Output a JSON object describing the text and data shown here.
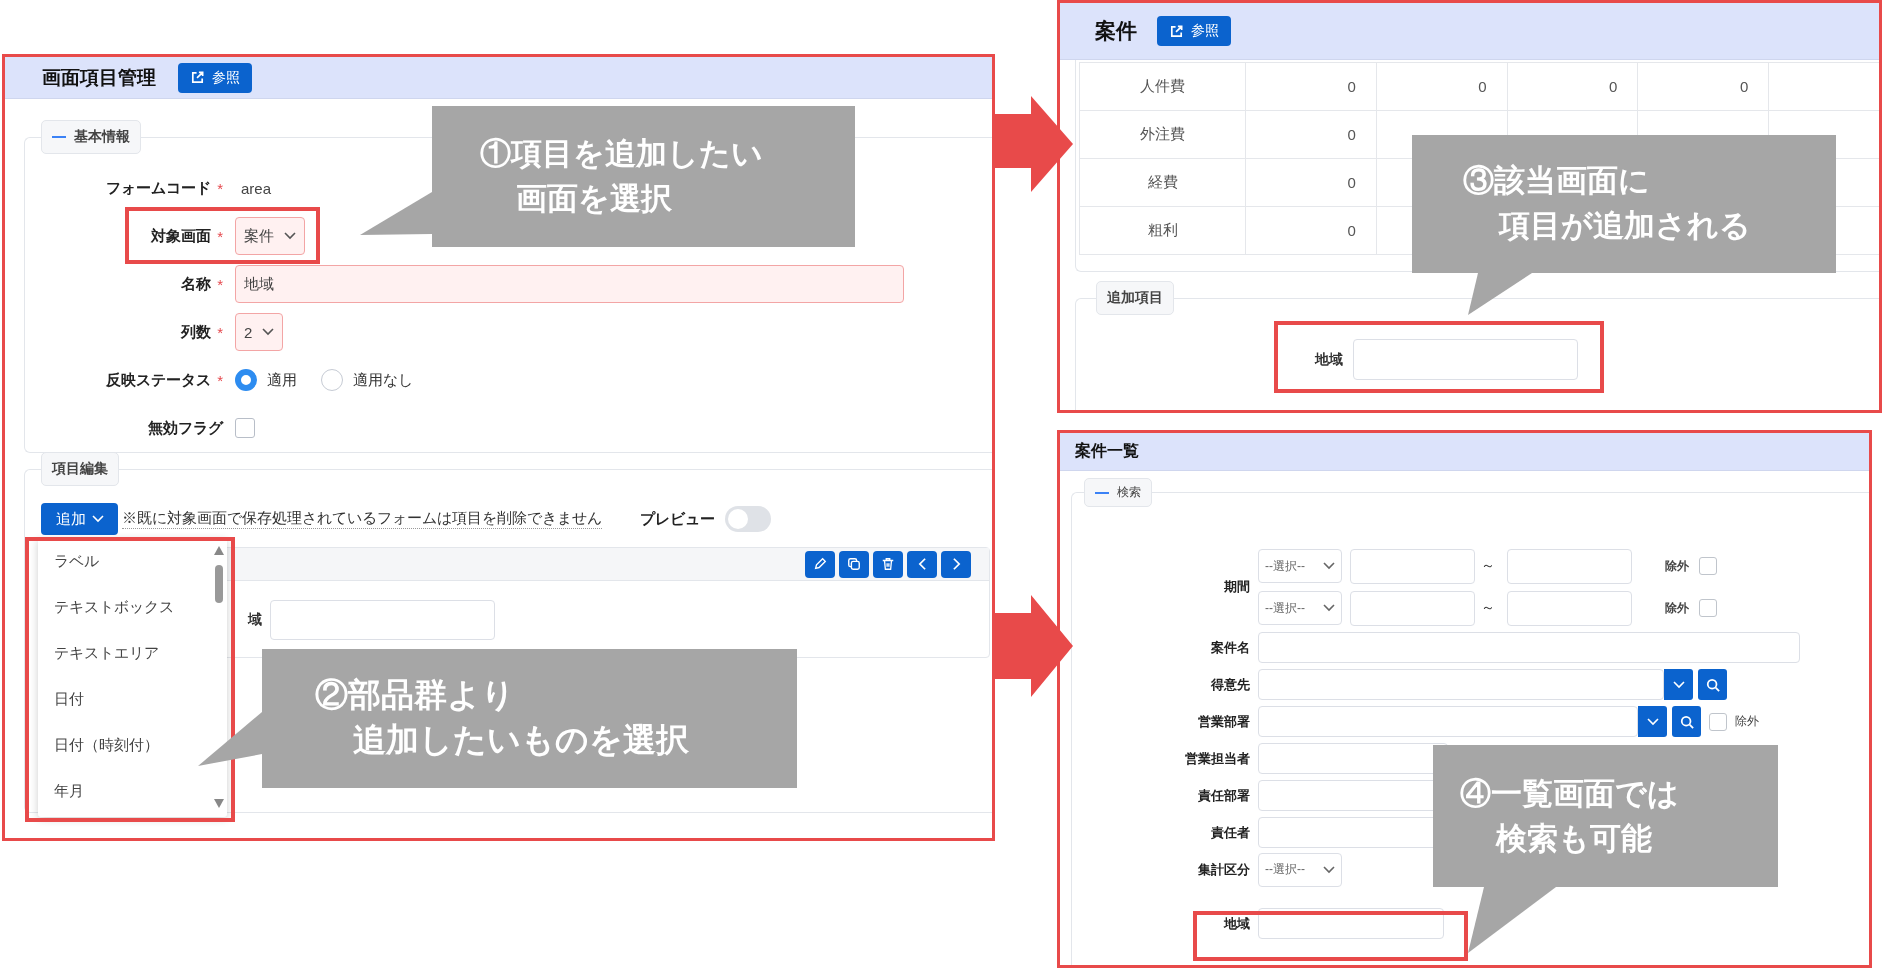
{
  "form_editor": {
    "title": "画面項目管理",
    "reference_button": "参照",
    "required_mark": "*",
    "basic_section": {
      "legend": "基本情報"
    },
    "fields": [
      {
        "kind": "text",
        "label": "フォームコード",
        "required": true,
        "value": "area"
      },
      {
        "kind": "select",
        "label": "対象画面",
        "required": true,
        "value": "案件",
        "invalid": true
      },
      {
        "kind": "input",
        "label": "名称",
        "required": true,
        "value": "地域",
        "invalid": true
      },
      {
        "kind": "select",
        "label": "列数",
        "required": true,
        "value": "2",
        "invalid": true
      },
      {
        "kind": "radio",
        "label": "反映ステータス",
        "required": true,
        "options": [
          {
            "label": "適用",
            "selected": true
          },
          {
            "label": "適用なし",
            "selected": false
          }
        ]
      },
      {
        "kind": "checkbox",
        "label": "無効フラグ",
        "required": false,
        "checked": false
      }
    ],
    "edit_section": {
      "legend": "項目編集",
      "add_button": "追加",
      "note": "※既に対象画面で保存処理されているフォームは項目を削除できません",
      "preview_label": "プレビュー",
      "preview_on": false,
      "preview_field_label": "域",
      "add_menu": {
        "expanded": true,
        "items": [
          "ラベル",
          "テキストボックス",
          "テキストエリア",
          "日付",
          "日付（時刻付）",
          "年月"
        ]
      }
    }
  },
  "detail_screen": {
    "title": "案件",
    "reference_button": "参照",
    "cost_rows": [
      {
        "label": "人件費",
        "values": [
          "0",
          "0",
          "0",
          "0"
        ]
      },
      {
        "label": "外注費",
        "values": [
          "0"
        ]
      },
      {
        "label": "経費",
        "values": [
          "0"
        ]
      },
      {
        "label": "粗利",
        "values": [
          "0"
        ]
      }
    ],
    "added_section": {
      "legend": "追加項目",
      "field_label": "地域"
    }
  },
  "list_screen": {
    "title": "案件一覧",
    "search_legend": "検索",
    "period": {
      "label": "期間",
      "rows": [
        {
          "select": "--選択--",
          "separator": "～",
          "exclude_label": "除外",
          "exclude_checked": false
        },
        {
          "select": "--選択--",
          "separator": "～",
          "exclude_label": "除外",
          "exclude_checked": false
        }
      ]
    },
    "fields": [
      {
        "kind": "wide_input",
        "label": "案件名"
      },
      {
        "kind": "lookup",
        "label": "得意先"
      },
      {
        "kind": "lookup",
        "label": "営業部署",
        "exclude_label": "除外",
        "exclude_checked": false
      },
      {
        "kind": "input",
        "label": "営業担当者"
      },
      {
        "kind": "input",
        "label": "責任部署"
      },
      {
        "kind": "input",
        "label": "責任者"
      },
      {
        "kind": "select",
        "label": "集計区分",
        "value": "--選択--"
      },
      {
        "kind": "short_input",
        "label": "地域"
      }
    ]
  },
  "callouts": [
    {
      "lines": [
        "①項目を追加したい",
        "画面を選択"
      ]
    },
    {
      "lines": [
        "②部品群より",
        "追加したいものを選択"
      ]
    },
    {
      "lines": [
        "③該当画面に",
        "項目が追加される"
      ]
    },
    {
      "lines": [
        "④一覧画面では",
        "検索も可能"
      ]
    }
  ]
}
